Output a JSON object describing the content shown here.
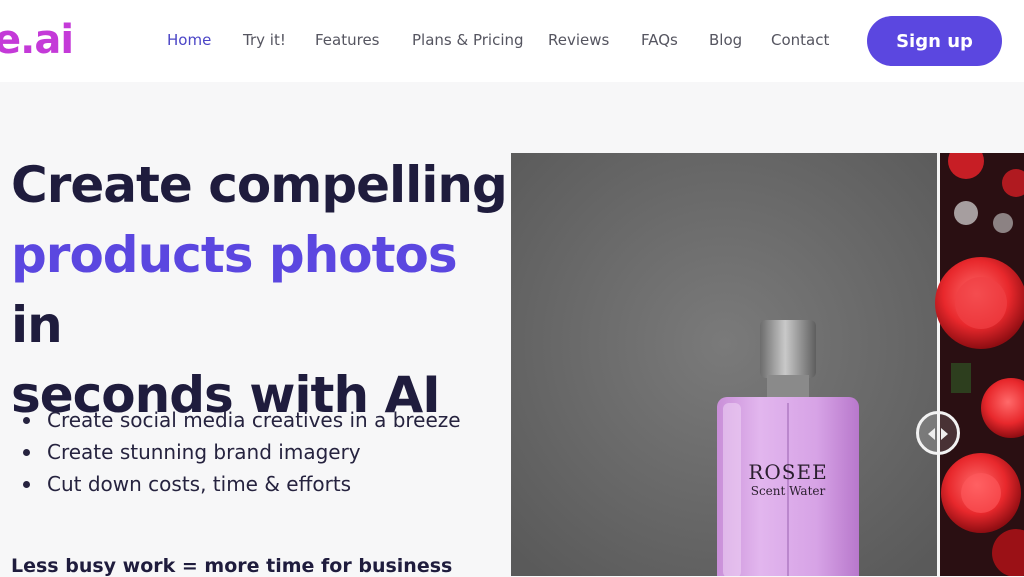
{
  "brand": {
    "logo_text": "e.ai",
    "color": "#c43ad8"
  },
  "nav": {
    "items": [
      {
        "label": "Home",
        "active": true
      },
      {
        "label": "Try it!"
      },
      {
        "label": "Features"
      },
      {
        "label": "Plans & Pricing"
      },
      {
        "label": "Reviews"
      },
      {
        "label": "FAQs"
      },
      {
        "label": "Blog"
      },
      {
        "label": "Contact"
      }
    ],
    "signup_label": "Sign up"
  },
  "hero": {
    "line1": "Create compelling",
    "accent": "products photos",
    "line2_rest": " in",
    "line3": "seconds with AI",
    "bullets": [
      "Create social media creatives in a breeze",
      "Create stunning brand imagery",
      "Cut down costs, time & efforts"
    ],
    "tagline": "Less busy work = more time for business"
  },
  "image": {
    "bottle_brand": "ROSEE",
    "bottle_sub": "Scent Water",
    "before_icon": "perfume-bottle-icon",
    "after_icon": "roses-background-icon",
    "handle_icon": "compare-slider-icon"
  },
  "colors": {
    "accent": "#5b47e0",
    "text_dark": "#1f1c3d",
    "nav_active": "#4b45c6"
  }
}
